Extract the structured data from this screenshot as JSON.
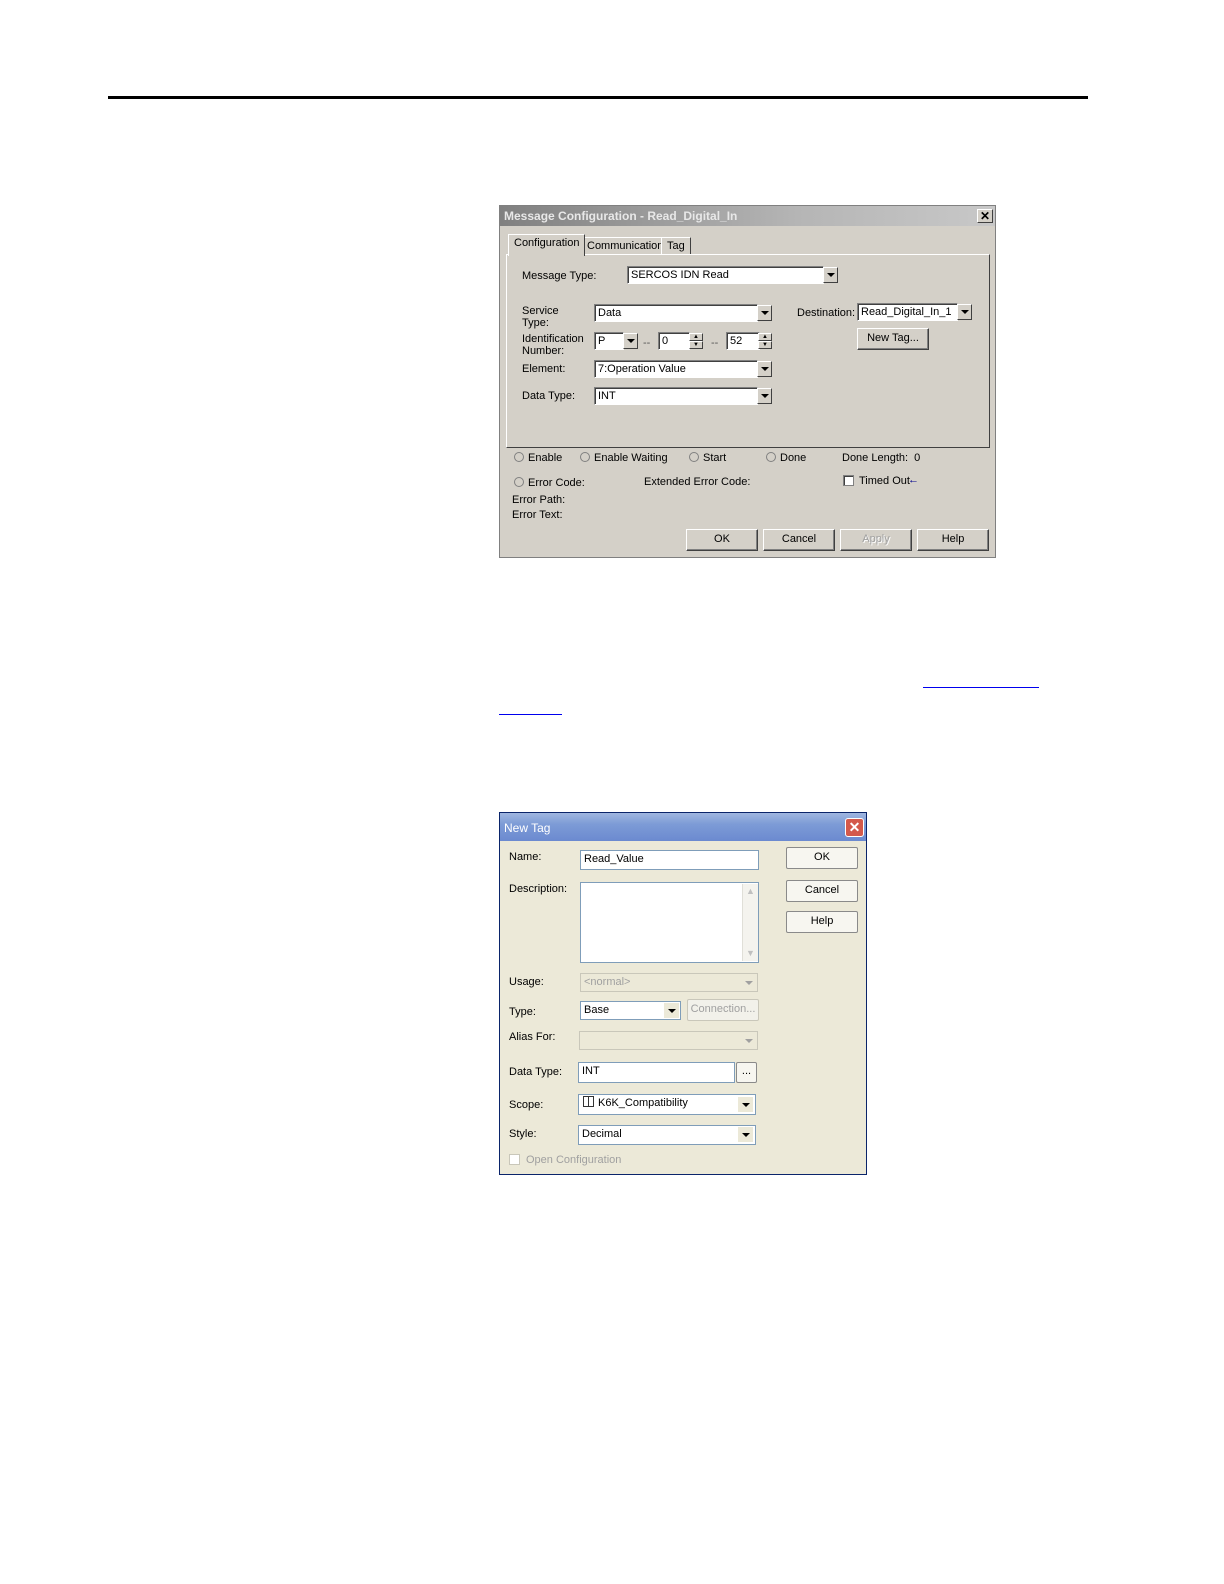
{
  "message_dialog": {
    "title": "Message Configuration - Read_Digital_In",
    "close_glyph": "✕",
    "tabs": [
      "Configuration",
      "Communication",
      "Tag"
    ],
    "message_type_label": "Message Type:",
    "message_type_value": "SERCOS IDN Read",
    "service_type_label_1": "Service",
    "service_type_label_2": "Type:",
    "service_type_value": "Data",
    "destination_label": "Destination:",
    "destination_value": "Read_Digital_In_1",
    "new_tag_button": "New Tag...",
    "identification_label_1": "Identification",
    "identification_label_2": "Number:",
    "id_prefix": "P",
    "id_separator": "--",
    "id_set": "0",
    "id_number": "52",
    "element_label": "Element:",
    "element_value": "7:Operation Value",
    "data_type_label": "Data Type:",
    "data_type_value": "INT",
    "status": {
      "enable": "Enable",
      "enable_waiting": "Enable Waiting",
      "start": "Start",
      "done": "Done",
      "done_length": "Done Length:  0",
      "error_code": "Error Code:",
      "extended_error_code": "Extended Error Code:",
      "timed_out": "Timed Out",
      "timed_out_arrow": "←",
      "error_path": "Error Path:",
      "error_text": "Error Text:"
    },
    "buttons": {
      "ok": "OK",
      "cancel": "Cancel",
      "apply": "Apply",
      "help": "Help"
    }
  },
  "new_tag_dialog": {
    "title": "New Tag",
    "close_glyph": "✕",
    "name_label": "Name:",
    "name_value": "Read_Value",
    "description_label": "Description:",
    "usage_label": "Usage:",
    "usage_value": "<normal>",
    "type_label": "Type:",
    "type_value": "Base",
    "connection_button": "Connection...",
    "alias_for_label": "Alias For:",
    "data_type_label": "Data Type:",
    "data_type_value": "INT",
    "browse_button": "...",
    "scope_label": "Scope:",
    "scope_value": "K6K_Compatibility",
    "style_label": "Style:",
    "style_value": "Decimal",
    "open_configuration": "Open Configuration",
    "buttons": {
      "ok": "OK",
      "cancel": "Cancel",
      "help": "Help"
    }
  }
}
